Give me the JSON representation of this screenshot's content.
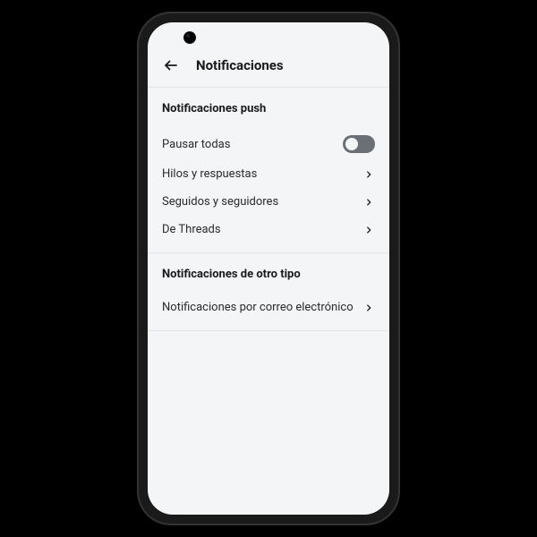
{
  "header": {
    "title": "Notificaciones"
  },
  "sections": {
    "push": {
      "title": "Notificaciones push",
      "pause_all": "Pausar todas",
      "items": [
        "Hilos y respuestas",
        "Seguidos y seguidores",
        "De Threads"
      ]
    },
    "other": {
      "title": "Notificaciones de otro tipo",
      "email": "Notificaciones por correo electrónico"
    }
  },
  "toggles": {
    "pause_all": false
  }
}
